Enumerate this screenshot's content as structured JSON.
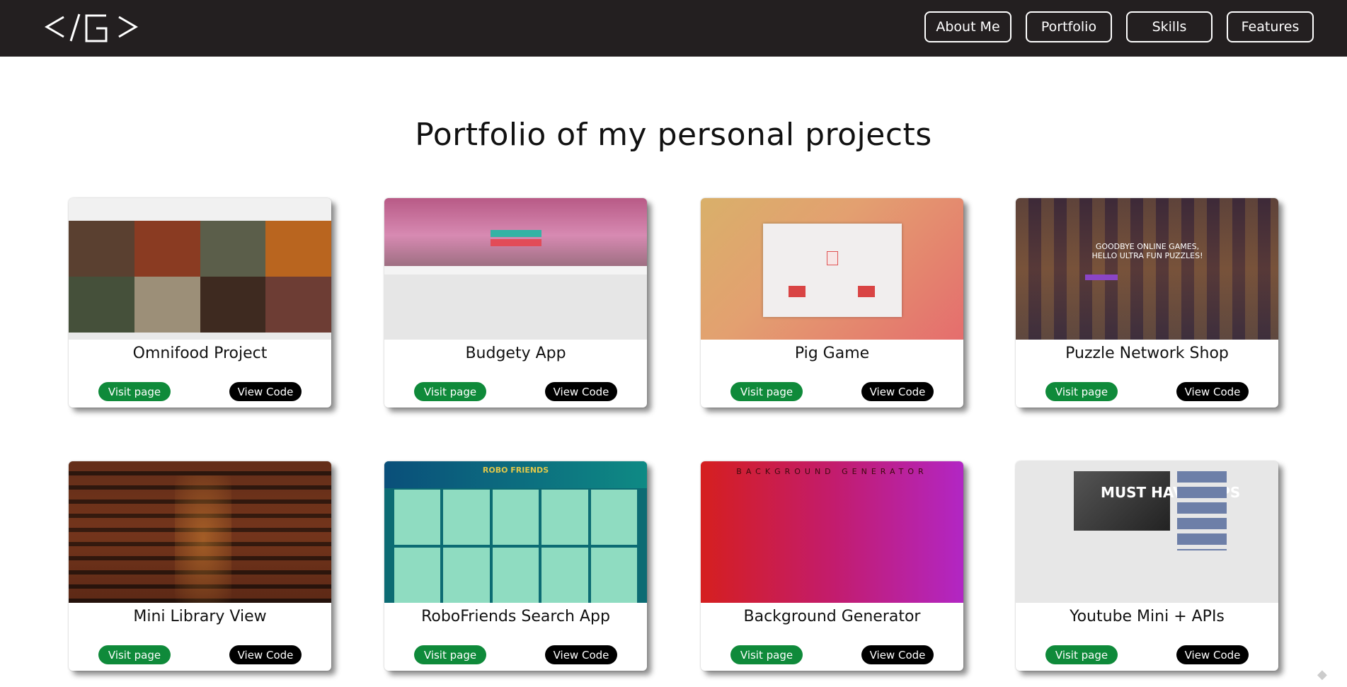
{
  "nav": {
    "logo": "</G>",
    "links": [
      "About Me",
      "Portfolio",
      "Skills",
      "Features"
    ]
  },
  "page_title": "Portfolio of my personal projects",
  "projects": [
    {
      "title": "Omnifood Project",
      "visit": "Visit page",
      "code": "View Code"
    },
    {
      "title": "Budgety App",
      "visit": "Visit page",
      "code": "View Code"
    },
    {
      "title": "Pig Game",
      "visit": "Visit page",
      "code": "View Code"
    },
    {
      "title": "Puzzle Network Shop",
      "visit": "Visit page",
      "code": "View Code"
    },
    {
      "title": "Mini Library View",
      "visit": "Visit page",
      "code": "View Code"
    },
    {
      "title": "RoboFriends Search App",
      "visit": "Visit page",
      "code": "View Code"
    },
    {
      "title": "Background Generator",
      "visit": "Visit page",
      "code": "View Code"
    },
    {
      "title": "Youtube Mini + APIs",
      "visit": "Visit page",
      "code": "View Code"
    }
  ],
  "thumbnails": {
    "puzzle_headline": "GOODBYE ONLINE GAMES, HELLO ULTRA FUN PUZZLES!",
    "robo_header": "ROBO FRIENDS",
    "bg_header": "BACKGROUND GENERATOR",
    "yt_text": "MUST HAVE APPS"
  },
  "colors": {
    "navbar": "#231f20",
    "visit_button": "#0f8a3a",
    "code_button": "#000000"
  },
  "icons": [
    "logo-icon",
    "corner-icon"
  ]
}
